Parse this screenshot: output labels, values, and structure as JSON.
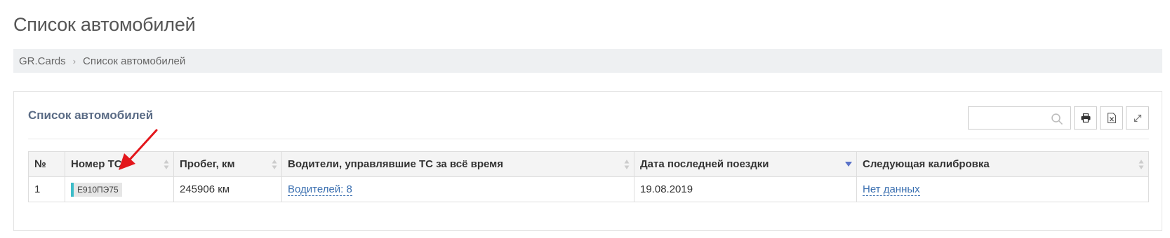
{
  "page": {
    "title": "Список автомобилей"
  },
  "breadcrumb": {
    "home": "GR.Cards",
    "separator": "›",
    "current": "Список автомобилей"
  },
  "panel": {
    "title": "Список автомобилей",
    "search": {
      "value": "",
      "placeholder": ""
    },
    "tools": {
      "print_icon": "print-icon",
      "excel_icon": "excel-export-icon",
      "expand_icon": "expand-icon"
    }
  },
  "table": {
    "columns": [
      "№",
      "Номер ТС",
      "Пробег, км",
      "Водители, управлявшие ТС за всё время",
      "Дата последней поездки",
      "Следующая калибровка"
    ],
    "sorted_column_index": 4,
    "sort_direction": "desc",
    "rows": [
      {
        "num": "1",
        "plate": "Е910ПЭ75",
        "mileage": "245906 км",
        "drivers": "Водителей: 8",
        "last_trip": "19.08.2019",
        "calibration": "Нет данных"
      }
    ]
  },
  "annotation": {
    "arrow_color": "#e3161b",
    "arrow_target": "plate"
  },
  "colors": {
    "plate_accent": "#3cbcc8",
    "link": "#3a6fb0",
    "panel_title": "#5a6b85",
    "sort_active": "#5a72c8"
  }
}
